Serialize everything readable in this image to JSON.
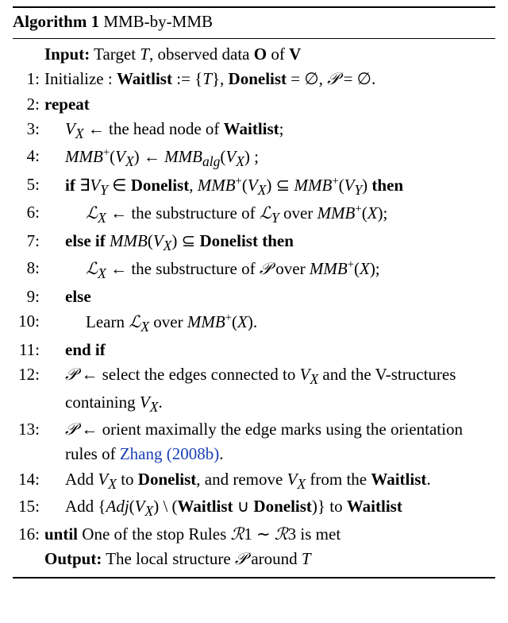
{
  "header": {
    "algolabel": "Algorithm 1",
    "name": "MMB-by-MMB"
  },
  "io": {
    "input_label": "Input:",
    "input_text_a": "Target ",
    "input_text_T": "T",
    "input_text_b": ", observed data ",
    "input_text_O": "O",
    "input_text_c": " of ",
    "input_text_V": "V",
    "output_label": "Output:",
    "output_text_a": "The local structure ",
    "output_P": "𝒫",
    "output_text_b": " around ",
    "output_T": "T"
  },
  "lines": {
    "l1_a": "Initialize : ",
    "l1_wait": "Waitlist",
    "l1_assign": " := {",
    "l1_T": "T",
    "l1_close": "}, ",
    "l1_done": "Donelist",
    "l1_eq_empty": " = ∅, ",
    "l1_P": "𝒫",
    "l1_eq_empty2": " = ∅.",
    "l2": "repeat",
    "l3_a": "V",
    "l3_sub": "X",
    "l3_arrow": " ← the head node of ",
    "l3_wait": "Waitlist",
    "l3_semi": ";",
    "l4_mmb": "MMB",
    "l4_plus": "+",
    "l4_open": "(",
    "l4_vx_v": "V",
    "l4_vx_x": "X",
    "l4_close": ")",
    "l4_arrow": " ← ",
    "l4_alg": "alg",
    "l4_semi": " ;",
    "l5_if": "if ",
    "l5_exists": "∃",
    "l5_vy_v": "V",
    "l5_vy_y": "Y",
    "l5_in": " ∈ ",
    "l5_done": "Donelist",
    "l5_comma": ", ",
    "l5_subseteq": " ⊆ ",
    "l5_then": "then",
    "l6_lx": "ℒ",
    "l6_X": "X",
    "l6_arrow": " ← the substructure of ",
    "l6_ly": "ℒ",
    "l6_Y": "Y",
    "l6_over": " over ",
    "l6_close": ";",
    "l7_elseif": "else if ",
    "l7_mmb": "MMB",
    "l7_subseteq": " ⊆ ",
    "l7_done": "Donelist",
    "l7_then": " then",
    "l8_arrow": " ← the substructure of ",
    "l8_P": "𝒫",
    "l8_over": " over ",
    "l9": "else",
    "l10_learn": "Learn ",
    "l10_over": " over ",
    "l10_dot": ".",
    "l11": "end if",
    "l12_P": "𝒫",
    "l12_arrow": " ← select the edges connected to ",
    "l12_and": " and the V-structures containing ",
    "l12_dot": ".",
    "l13_P": "𝒫",
    "l13_arrow": " ← orient maximally the edge marks using the orientation rules of ",
    "l13_cite": "Zhang",
    "l13_year": " (2008b)",
    "l13_dot": ".",
    "l14_a": "Add ",
    "l14_to": " to ",
    "l14_done": "Donelist",
    "l14_b": ", and remove ",
    "l14_from": " from the ",
    "l14_wait": "Waitlist",
    "l14_dot": ".",
    "l15_a": "Add  {",
    "l15_adj": "Adj",
    "l15_open": "(",
    "l15_close": ")",
    "l15_setminus": " \\ (",
    "l15_wait": "Waitlist",
    "l15_cup": " ∪ ",
    "l15_done": "Donelist",
    "l15_close2": ")} to ",
    "l15_wait2": "Waitlist",
    "l16_until": "until",
    "l16_text": " One of the stop Rules ",
    "l16_R": "ℛ",
    "l16_1": "1",
    "l16_tilde": " ∼ ",
    "l16_3": "3",
    "l16_met": " is met"
  }
}
